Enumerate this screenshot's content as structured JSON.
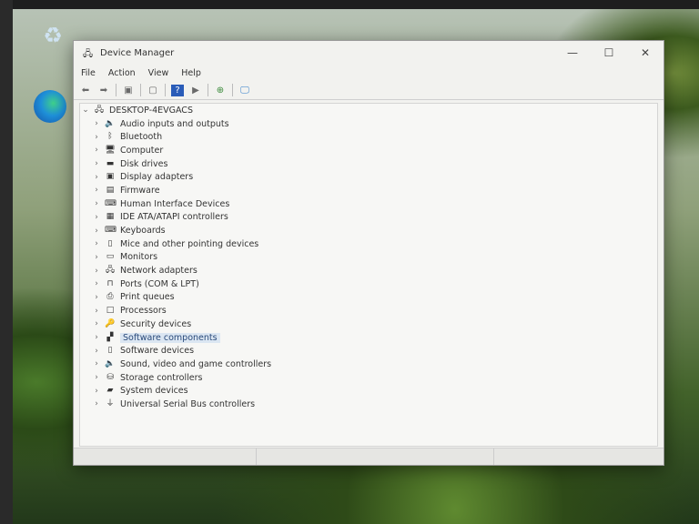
{
  "desktop": {
    "icons": [
      {
        "name": "recycle-bin"
      },
      {
        "name": "edge"
      }
    ]
  },
  "window": {
    "title": "Device Manager",
    "controls": {
      "minimize": "—",
      "maximize": "☐",
      "close": "✕"
    },
    "menu": [
      "File",
      "Action",
      "View",
      "Help"
    ],
    "toolbar": [
      "back",
      "forward",
      "properties",
      "scan",
      "help",
      "run",
      "update-driver",
      "monitor"
    ],
    "tree": {
      "root": "DESKTOP-4EVGACS",
      "items": [
        {
          "label": "Audio inputs and outputs",
          "icon": "🔈"
        },
        {
          "label": "Bluetooth",
          "icon": "ᛒ"
        },
        {
          "label": "Computer",
          "icon": "🖥"
        },
        {
          "label": "Disk drives",
          "icon": "▬"
        },
        {
          "label": "Display adapters",
          "icon": "▣"
        },
        {
          "label": "Firmware",
          "icon": "▤"
        },
        {
          "label": "Human Interface Devices",
          "icon": "⌨"
        },
        {
          "label": "IDE ATA/ATAPI controllers",
          "icon": "▦"
        },
        {
          "label": "Keyboards",
          "icon": "⌨"
        },
        {
          "label": "Mice and other pointing devices",
          "icon": "▯"
        },
        {
          "label": "Monitors",
          "icon": "▭"
        },
        {
          "label": "Network adapters",
          "icon": "🖧"
        },
        {
          "label": "Ports (COM & LPT)",
          "icon": "⊓"
        },
        {
          "label": "Print queues",
          "icon": "⎙"
        },
        {
          "label": "Processors",
          "icon": "□"
        },
        {
          "label": "Security devices",
          "icon": "🔑"
        },
        {
          "label": "Software components",
          "icon": "▞",
          "selected": true
        },
        {
          "label": "Software devices",
          "icon": "▯"
        },
        {
          "label": "Sound, video and game controllers",
          "icon": "🔈"
        },
        {
          "label": "Storage controllers",
          "icon": "⛁"
        },
        {
          "label": "System devices",
          "icon": "▰"
        },
        {
          "label": "Universal Serial Bus controllers",
          "icon": "⏚"
        }
      ]
    }
  }
}
